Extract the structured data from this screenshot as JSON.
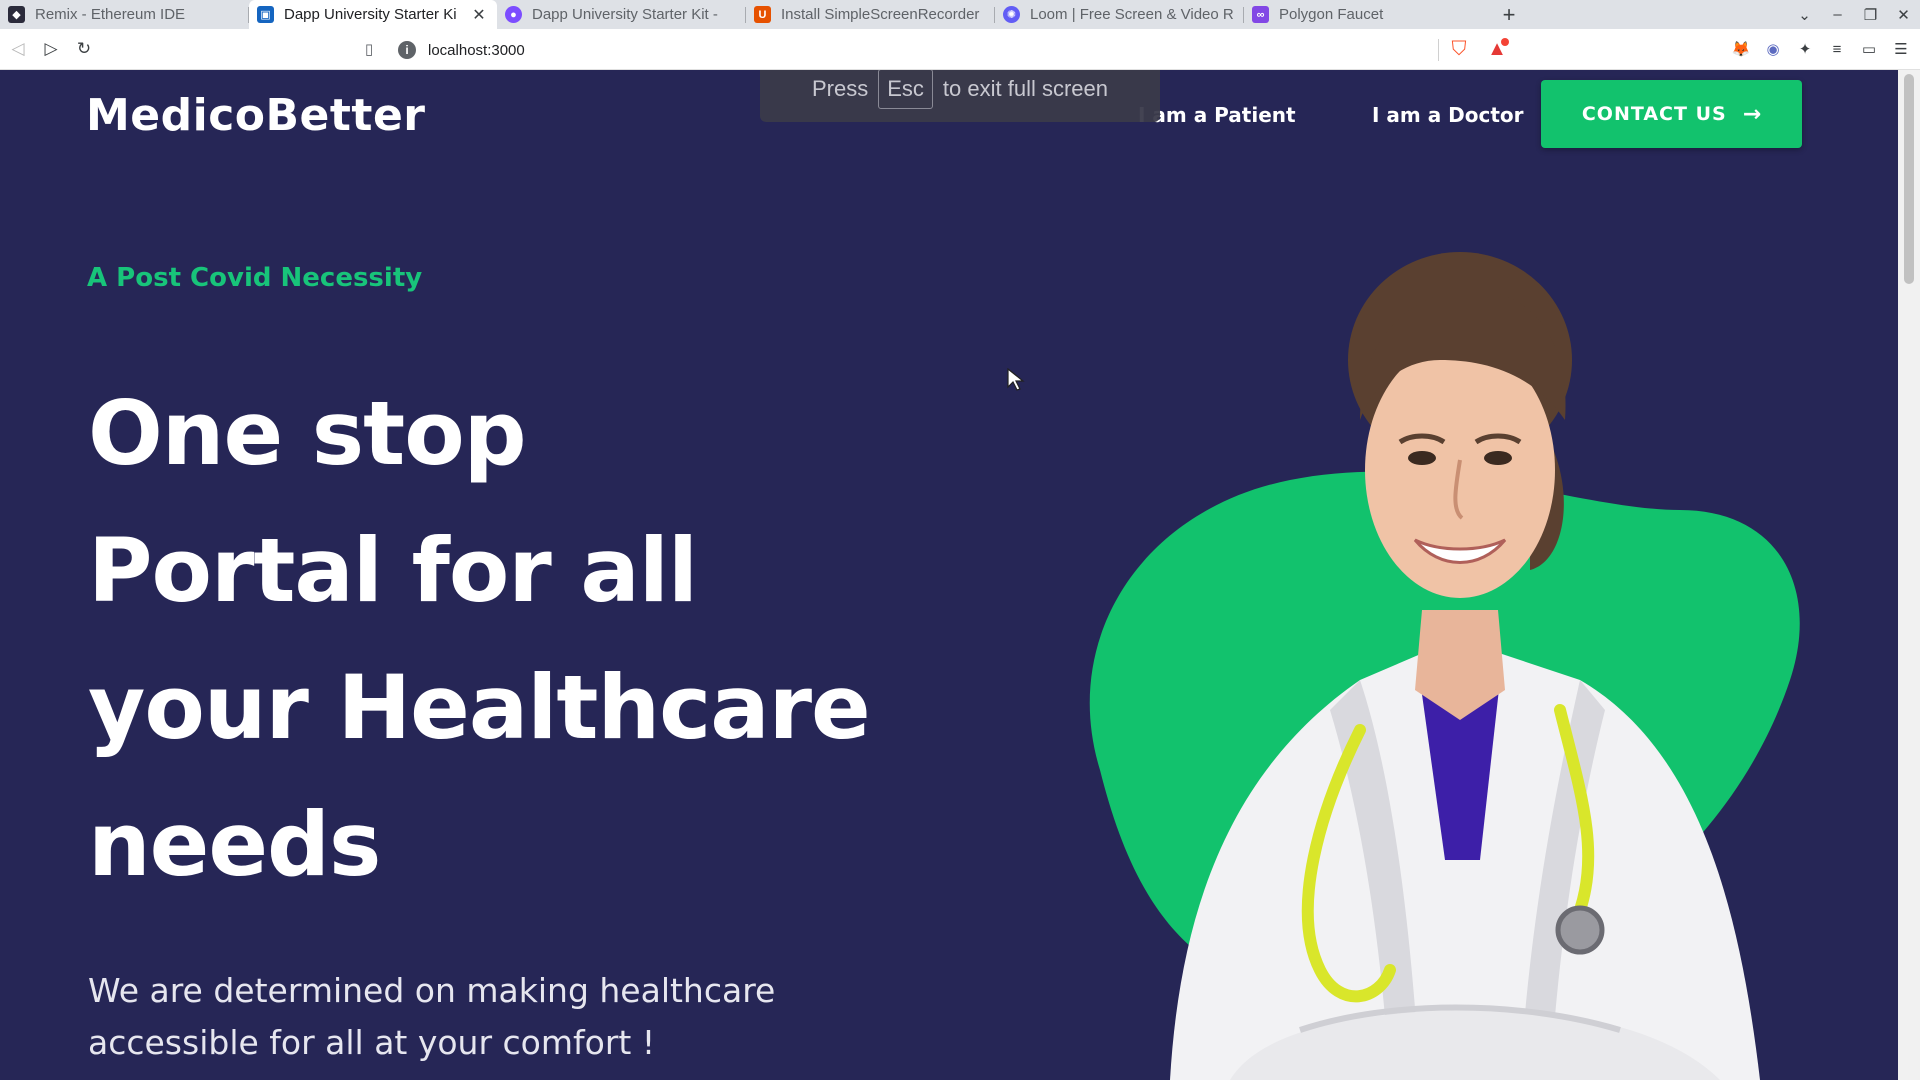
{
  "browser": {
    "tabs": [
      {
        "label": "Remix - Ethereum IDE",
        "favicon": "remix-icon",
        "color": "#2b2b3b",
        "active": false
      },
      {
        "label": "Dapp University Starter Ki",
        "favicon": "dapp-university-icon",
        "color": "#1565c0",
        "active": true
      },
      {
        "label": "Dapp University Starter Kit - ",
        "favicon": "dapp-university-icon",
        "color": "#7c4dff",
        "active": false
      },
      {
        "label": "Install SimpleScreenRecorder",
        "favicon": "ubuntu-icon",
        "color": "#e65100",
        "active": false
      },
      {
        "label": "Loom | Free Screen & Video Re",
        "favicon": "loom-icon",
        "color": "#625df5",
        "active": false
      },
      {
        "label": "Polygon Faucet",
        "favicon": "polygon-icon",
        "color": "#8247e5",
        "active": false
      }
    ],
    "address": "localhost:3000",
    "fullscreen_toast": {
      "press": "Press",
      "key": "Esc",
      "rest": "to exit full screen"
    }
  },
  "site": {
    "logo": "MedicoBetter",
    "nav": {
      "patient": "I am a Patient",
      "doctor": "I am a Doctor",
      "contact": "CONTACT US"
    },
    "hero": {
      "eyebrow": "A Post Covid Necessity",
      "headline_lines": [
        "One stop",
        "Portal for all",
        "your Healthcare",
        "needs"
      ],
      "subtext_lines": [
        "We are determined on making healthcare",
        "accessible for all at your comfort !"
      ]
    },
    "colors": {
      "background": "#262656",
      "accent_green": "#12c26d",
      "text": "#ffffff"
    }
  }
}
